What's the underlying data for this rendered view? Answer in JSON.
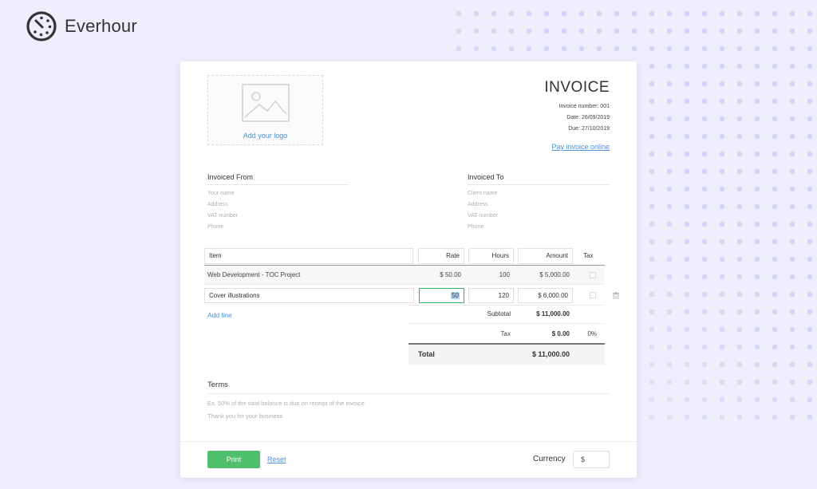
{
  "brand": {
    "name": "Everhour",
    "icon": "everhour-logo-icon"
  },
  "invoice": {
    "logo_placeholder_label": "Add your logo",
    "title": "INVOICE",
    "number": "Invoice number: 001",
    "date": "Date: 26/09/2019",
    "due": "Due: 27/10/2019",
    "pay_link": "Pay invoice online"
  },
  "from": {
    "heading": "Invoiced From",
    "lines": [
      "Your name",
      "Address",
      "VAT number",
      "Phone"
    ]
  },
  "to": {
    "heading": "Invoiced To",
    "lines": [
      "Client name",
      "Address",
      "VAT number",
      "Phone"
    ]
  },
  "table": {
    "headers": {
      "item": "Item",
      "rate": "Rate",
      "hours": "Hours",
      "amount": "Amount",
      "tax": "Tax"
    },
    "rows": [
      {
        "item": "Web Development - TOC Project",
        "rate": "$ 50.00",
        "hours": "100",
        "amount": "$ 5,000.00"
      },
      {
        "item": "Cover illustrations",
        "rate": "50",
        "hours": "120",
        "amount": "$ 6,000.00"
      }
    ],
    "add_line": "Add line"
  },
  "summary": {
    "subtotal_label": "Subtotal",
    "subtotal": "$ 11,000.00",
    "tax_label": "Tax",
    "tax_amount": "$ 0.00",
    "tax_percent": "0%",
    "total_label": "Total",
    "total": "$ 11,000.00"
  },
  "terms": {
    "heading": "Terms",
    "line1": "Ex. 50% of the total balance is due on receipt of the invoice.",
    "line2": "Thank you for your business"
  },
  "footer": {
    "print": "Print",
    "reset": "Reset",
    "currency_label": "Currency",
    "currency_value": "$"
  },
  "colors": {
    "background": "#eeeefc",
    "accent_green": "#4fbe6d",
    "link_blue": "#4a90d9"
  }
}
